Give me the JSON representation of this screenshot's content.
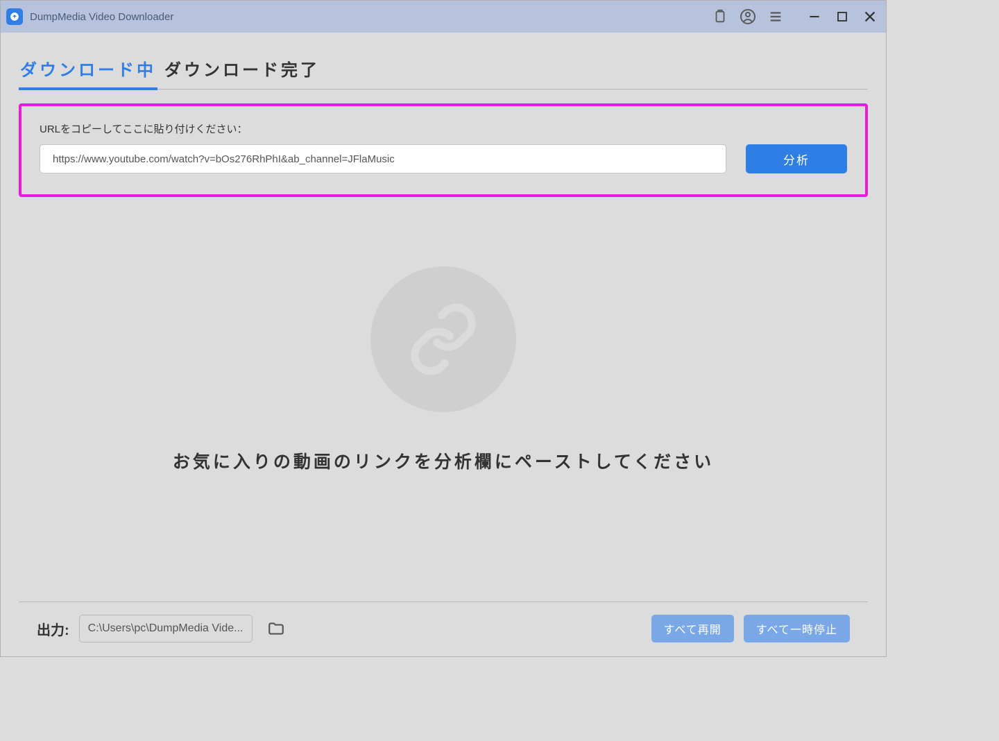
{
  "titlebar": {
    "app_name": "DumpMedia Video Downloader"
  },
  "tabs": {
    "downloading": "ダウンロード中",
    "completed": "ダウンロード完了"
  },
  "url_panel": {
    "label": "URLをコピーしてここに貼り付けください：",
    "input_value": "https://www.youtube.com/watch?v=bOs276RhPhI&ab_channel=JFlaMusic",
    "analyze_label": "分析"
  },
  "empty_state": {
    "message": "お気に入りの動画のリンクを分析欄にペーストしてください"
  },
  "footer": {
    "output_label": "出力:",
    "output_path": "C:\\Users\\pc\\DumpMedia Vide...",
    "resume_all": "すべて再開",
    "pause_all": "すべて一時停止"
  }
}
